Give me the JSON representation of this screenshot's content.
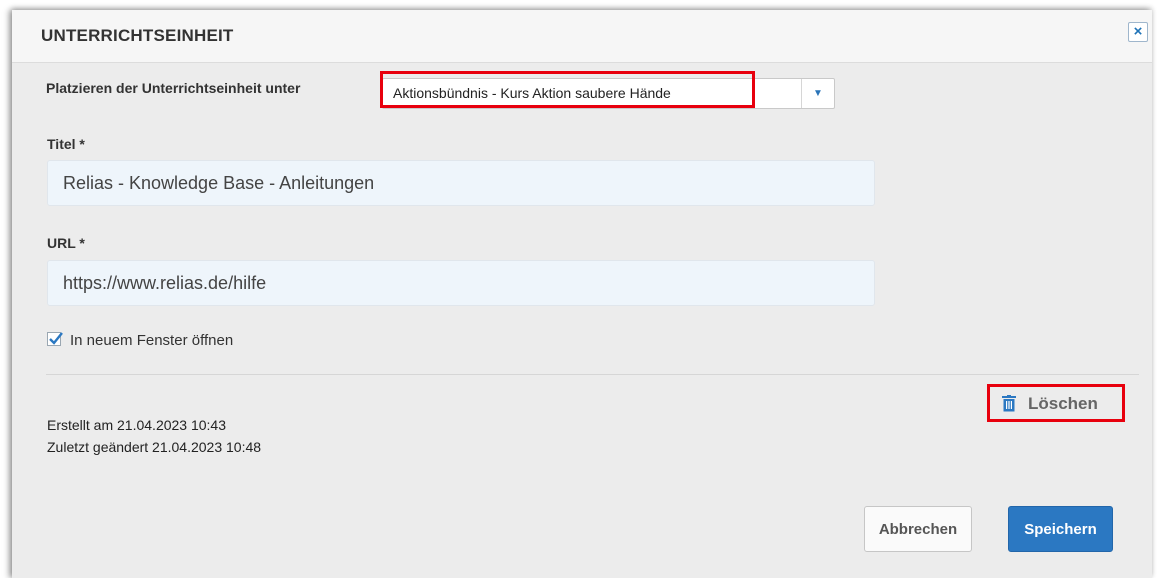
{
  "dialog": {
    "title": "UNTERRICHTSEINHEIT",
    "close_label": "×"
  },
  "form": {
    "placement_label": "Platzieren der Unterrichtseinheit unter",
    "placement_value": "Aktionsbündnis - Kurs Aktion saubere Hände",
    "title_label": "Titel *",
    "title_value": "Relias - Knowledge Base - Anleitungen",
    "url_label": "URL *",
    "url_value": "https://www.relias.de/hilfe",
    "new_window_label": "In neuem Fenster öffnen",
    "new_window_checked": true
  },
  "meta": {
    "created": "Erstellt am 21.04.2023 10:43",
    "modified": "Zuletzt geändert 21.04.2023 10:48"
  },
  "actions": {
    "delete_label": "Löschen",
    "cancel_label": "Abbrechen",
    "save_label": "Speichern"
  },
  "colors": {
    "highlight": "#e8000d",
    "primary": "#2b78c2"
  }
}
